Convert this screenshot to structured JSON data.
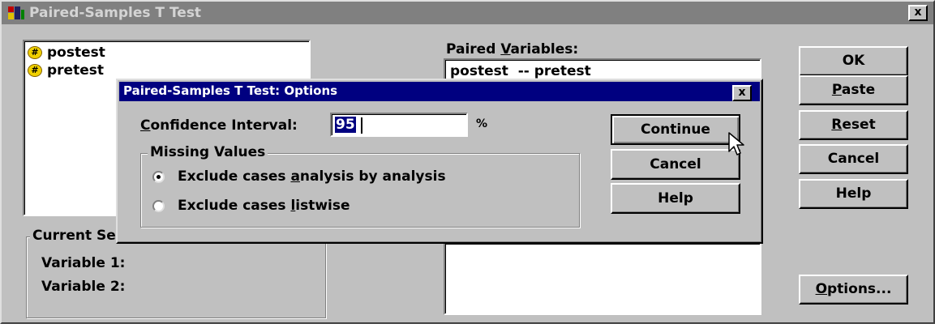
{
  "main_dialog": {
    "title": "Paired-Samples T Test",
    "close_label": "x",
    "variables": [
      {
        "name": "postest",
        "icon": "numeric-variable-icon"
      },
      {
        "name": "pretest",
        "icon": "numeric-variable-icon"
      }
    ],
    "paired_variables": {
      "label_pre": "Paired ",
      "label_key": "V",
      "label_post": "ariables:",
      "rows": [
        "postest  -- pretest"
      ]
    },
    "current_selections": {
      "title": "Current Selections",
      "variable1": "Variable 1:",
      "variable2": "Variable 2:"
    },
    "buttons": {
      "ok": "OK",
      "paste": {
        "key": "P",
        "rest": "aste"
      },
      "reset": {
        "key": "R",
        "rest": "eset"
      },
      "cancel": "Cancel",
      "help": "Help",
      "options": {
        "key": "O",
        "rest": "ptions..."
      }
    }
  },
  "options_dialog": {
    "title": "Paired-Samples T Test: Options",
    "close_label": "x",
    "confidence_interval": {
      "key": "C",
      "label_rest": "onfidence Interval:",
      "value": "95",
      "unit": "%"
    },
    "missing_values": {
      "title": "Missing Values",
      "options": [
        {
          "pre": "Exclude cases ",
          "key": "a",
          "post": "nalysis by analysis",
          "selected": true
        },
        {
          "pre": "Exclude cases ",
          "key": "l",
          "post": "istwise",
          "selected": false
        }
      ]
    },
    "buttons": {
      "continue": "Continue",
      "cancel": "Cancel",
      "help": "Help"
    }
  },
  "colors": {
    "dialog_face": "#c0c0c0",
    "inactive_titlebar": "#808080",
    "active_titlebar": "#000080",
    "selection": "#000080"
  }
}
